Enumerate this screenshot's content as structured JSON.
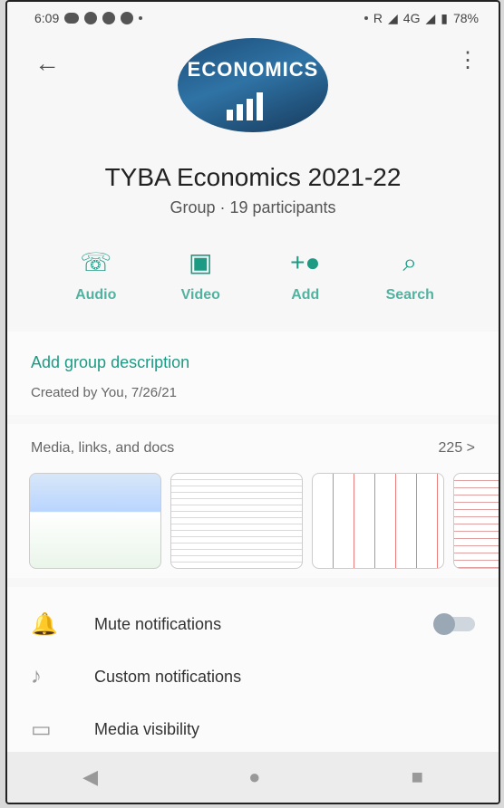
{
  "status": {
    "time": "6:09",
    "network": "R",
    "signal": "4G",
    "battery": "78%"
  },
  "header": {
    "back_icon": "back-arrow-icon",
    "menu_icon": "more-icon",
    "avatar_text": "ECONOMICS",
    "title": "TYBA Economics 2021-22",
    "subtitle": "Group · 19 participants"
  },
  "actions": [
    {
      "label": "Audio",
      "icon": "phone-icon"
    },
    {
      "label": "Video",
      "icon": "video-icon"
    },
    {
      "label": "Add",
      "icon": "add-person-icon"
    },
    {
      "label": "Search",
      "icon": "search-icon"
    }
  ],
  "description": {
    "link": "Add group description",
    "meta": "Created by You, 7/26/21"
  },
  "media": {
    "title": "Media, links, and docs",
    "count": "225 >"
  },
  "settings": [
    {
      "label": "Mute notifications",
      "icon": "bell-icon"
    },
    {
      "label": "Custom notifications",
      "icon": "music-note-icon"
    },
    {
      "label": "Media visibility",
      "icon": "image-icon"
    }
  ],
  "accent": "#1b9b84"
}
